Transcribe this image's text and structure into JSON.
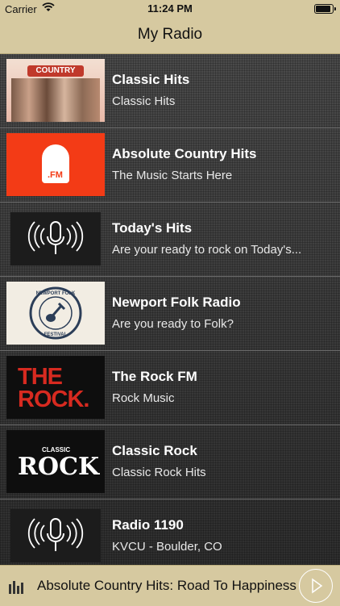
{
  "status": {
    "carrier": "Carrier",
    "time": "11:24 PM"
  },
  "nav": {
    "title": "My Radio"
  },
  "stations": [
    {
      "name": "Classic Hits",
      "subtitle": "Classic Hits",
      "thumb_text": "COUNTRY HITS"
    },
    {
      "name": "Absolute Country Hits",
      "subtitle": "The Music Starts Here",
      "thumb_text": ".FM"
    },
    {
      "name": "Today's Hits",
      "subtitle": "Are your ready to rock on Today's..."
    },
    {
      "name": "Newport Folk Radio",
      "subtitle": "Are you ready to Folk?",
      "thumb_text_top": "NEWPORT FOLK",
      "thumb_text_bottom": "FESTIVAL"
    },
    {
      "name": "The Rock FM",
      "subtitle": "Rock Music",
      "thumb_text": "THE ROCK."
    },
    {
      "name": "Classic Rock",
      "subtitle": "Classic Rock Hits",
      "thumb_text_small": "CLASSIC",
      "thumb_text": "ROCK"
    },
    {
      "name": "Radio 1190",
      "subtitle": "KVCU - Boulder, CO"
    }
  ],
  "player": {
    "now_playing": "Absolute Country Hits: Road To Happiness"
  },
  "colors": {
    "bar": "#d6c9a0",
    "accent_red": "#f33b16"
  }
}
